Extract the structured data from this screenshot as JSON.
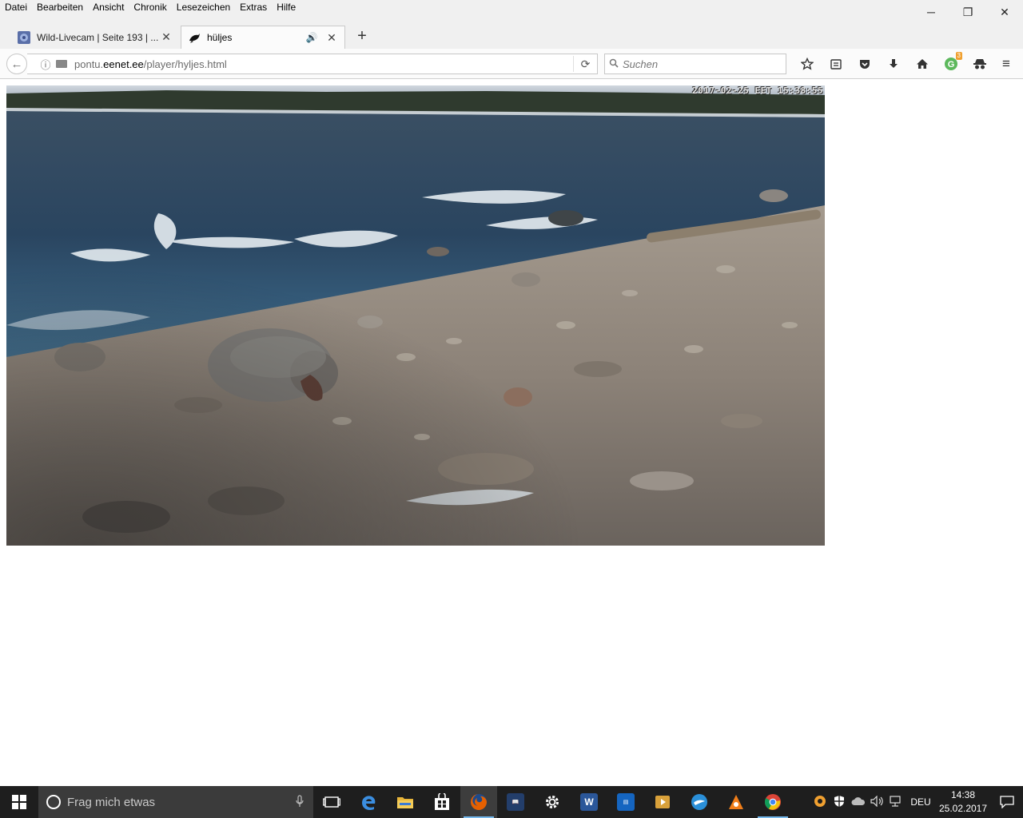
{
  "menubar": {
    "items": [
      "Datei",
      "Bearbeiten",
      "Ansicht",
      "Chronik",
      "Lesezeichen",
      "Extras",
      "Hilfe"
    ]
  },
  "window_controls": {
    "minimize": "─",
    "restore": "❐",
    "close": "✕"
  },
  "tabs": [
    {
      "title": "Wild-Livecam | Seite 193 | ...",
      "favicon": "forum-favicon-icon",
      "close": "✕"
    },
    {
      "title": "hüljes",
      "favicon": "seal-favicon-icon",
      "audio": "🔊",
      "close": "✕"
    }
  ],
  "newtab_label": "+",
  "navbar": {
    "back": "←",
    "info": "ⓘ",
    "url_prefix": "pontu.",
    "url_host": "eenet.ee",
    "url_path": "/player/hyljes.html",
    "reload": "⟳",
    "search_icon": "🔍",
    "search_placeholder": "Suchen",
    "toolbar_icons": [
      "bookmark-star-icon",
      "reading-list-icon",
      "pocket-icon",
      "download-icon",
      "home-icon",
      "extension-icon",
      "incognito-icon"
    ],
    "extension_badge": "3",
    "menu": "≡"
  },
  "video": {
    "timestamp": "2017-02-25 EET 15:38:55"
  },
  "taskbar": {
    "search_placeholder": "Frag mich etwas",
    "apps": [
      {
        "name": "task-view-icon",
        "color": "#1e1e1e"
      },
      {
        "name": "edge-icon",
        "color": "#1e73be"
      },
      {
        "name": "file-explorer-icon",
        "color": "#e8b53a"
      },
      {
        "name": "store-icon",
        "color": "#1e1e1e"
      },
      {
        "name": "firefox-icon",
        "color": "#e66000"
      },
      {
        "name": "kindle-icon",
        "color": "#233e6b"
      },
      {
        "name": "settings-icon",
        "color": "#1e1e1e"
      },
      {
        "name": "word-icon",
        "color": "#2b579a"
      },
      {
        "name": "app-blue-icon",
        "color": "#1565c0"
      },
      {
        "name": "media-player-icon",
        "color": "#d9a13a"
      },
      {
        "name": "bird-app-icon",
        "color": "#2a8fd8"
      },
      {
        "name": "avast-icon",
        "color": "#f07e1a"
      },
      {
        "name": "chrome-icon",
        "color": "#4caf50"
      }
    ],
    "tray": {
      "language": "DEU",
      "time": "14:38",
      "date": "25.02.2017"
    }
  },
  "colors": {
    "taskbar_bg": "#1e1e1e",
    "accent": "#76b9ed",
    "chrome_bg": "#f0f0f0"
  }
}
